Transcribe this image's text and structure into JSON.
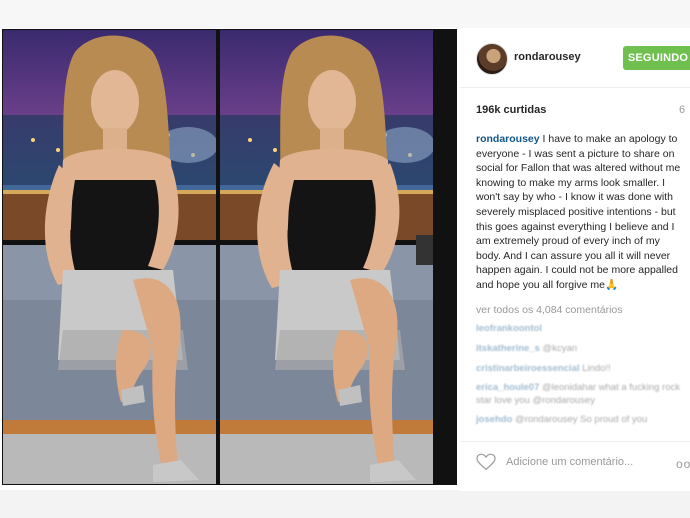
{
  "post": {
    "username": "rondarousey",
    "follow_label": "SEGUINDO",
    "likes": "196k curtidas",
    "time": "6",
    "caption_user": "rondarousey",
    "caption_text": " I have to make an apology to everyone - I was sent a picture to share on social for Fallon that was altered without me knowing to make my arms look smaller. I won't say by who - I know it was done with severely misplaced positive intentions - but this goes against everything I believe and I am extremely proud of every inch of my body. And I can assure you all it will never happen again. I could not be more appalled and hope you all forgive me🙏",
    "view_all": "ver todos os 4,084 comentários",
    "add_comment_placeholder": "Adicione um comentário...",
    "more_label": "oo"
  },
  "comments": [
    {
      "user": "leofrankoontol",
      "text": ""
    },
    {
      "user": "itskatherine_s",
      "text": " @kcyan"
    },
    {
      "user": "cristinarbeiroessencial",
      "text": " Lindo!!"
    },
    {
      "user": "erica_houle07",
      "text": " @leonidahar what a fucking rock star love you @rondarousey"
    },
    {
      "user": "josehdo",
      "text": " @rondarousey So proud of you"
    }
  ],
  "icons": {
    "heart": "heart-icon",
    "avatar": "profile-avatar"
  },
  "colors": {
    "follow_button": "#70c050",
    "username": "#125688"
  }
}
